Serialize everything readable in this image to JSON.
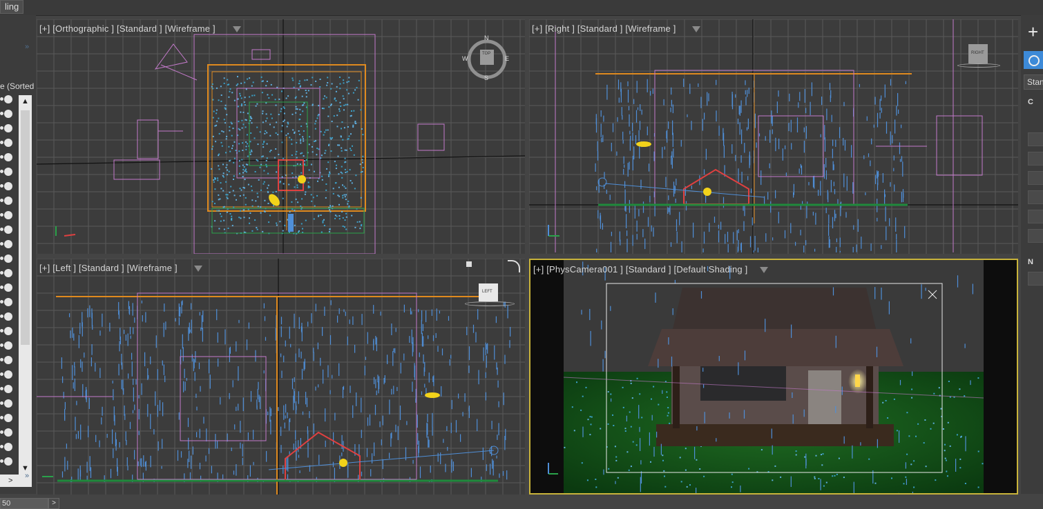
{
  "menu": {
    "tab_label": "ling"
  },
  "left_panel": {
    "sorted_label": "e (Sorted",
    "chevron": "»",
    "scroll_up": "▲",
    "scroll_down": "▼",
    "collapse_arrow": ">"
  },
  "viewports": {
    "top_left": {
      "label": "[+] [Orthographic ] [Standard ] [Wireframe ]",
      "viewcube_face": "TOP",
      "compass": {
        "n": "N",
        "s": "S",
        "e": "E",
        "w": "W"
      }
    },
    "top_right": {
      "label": "[+] [Right ] [Standard ] [Wireframe ]",
      "viewcube_face": "RIGHT"
    },
    "bottom_left": {
      "label": "[+] [Left ] [Standard ] [Wireframe ]",
      "viewcube_face": "LEFT"
    },
    "bottom_right": {
      "label": "[+] [PhysCamera001 ] [Standard ] [Default Shading ]"
    }
  },
  "right_panel": {
    "create_icon": "+",
    "dropdown_label": "Stan",
    "rollout_1": "C",
    "rollout_2": "N"
  },
  "status_bar": {
    "frame_value": "50",
    "next_label": ">"
  },
  "colors": {
    "grid": "#5a5a5a",
    "rain": "#4f8fd8",
    "helper": "#c47acb",
    "orange": "#e08a1e",
    "ground": "#1f8a3c",
    "house": "#e04040",
    "active_border": "#c9b43a"
  }
}
